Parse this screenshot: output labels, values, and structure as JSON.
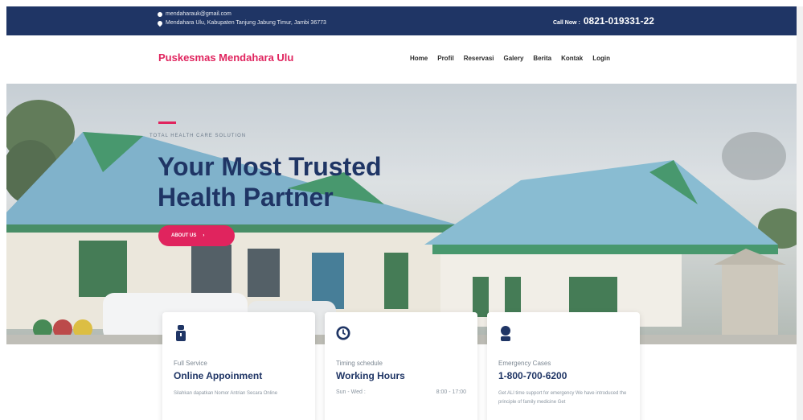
{
  "topbar": {
    "email": "mendaharauk@gmail.com",
    "address": "Mendahara Ulu, Kabupaten Tanjung Jabung Timur, Jambi 36773",
    "call_label": "Call Now :",
    "call_number": "0821-019331-22"
  },
  "header": {
    "brand": "Puskesmas Mendahara Ulu",
    "nav": [
      "Home",
      "Profil",
      "Reservasi",
      "Galery",
      "Berita",
      "Kontak",
      "Login"
    ]
  },
  "hero": {
    "eyebrow": "TOTAL HEALTH CARE SOLUTION",
    "title_line1": "Your Most Trusted",
    "title_line2": "Health Partner",
    "button_label": "ABOUT US"
  },
  "cards": [
    {
      "icon": "doctor-icon",
      "subtitle": "Full Service",
      "title": "Online Appoinment",
      "desc": "Silahkan dapatkan Nomor Antrian Secara Online"
    },
    {
      "icon": "clock-icon",
      "subtitle": "Timing schedule",
      "title": "Working Hours",
      "hours_day": "Sun - Wed :",
      "hours_time": "8:00 - 17:00"
    },
    {
      "icon": "emergency-icon",
      "subtitle": "Emergency Cases",
      "title": "1-800-700-6200",
      "desc": "Get ALl time support for emergency We have introduced the principle of family medicine Get"
    }
  ],
  "colors": {
    "navy": "#1f3565",
    "accent": "#e0245e"
  }
}
